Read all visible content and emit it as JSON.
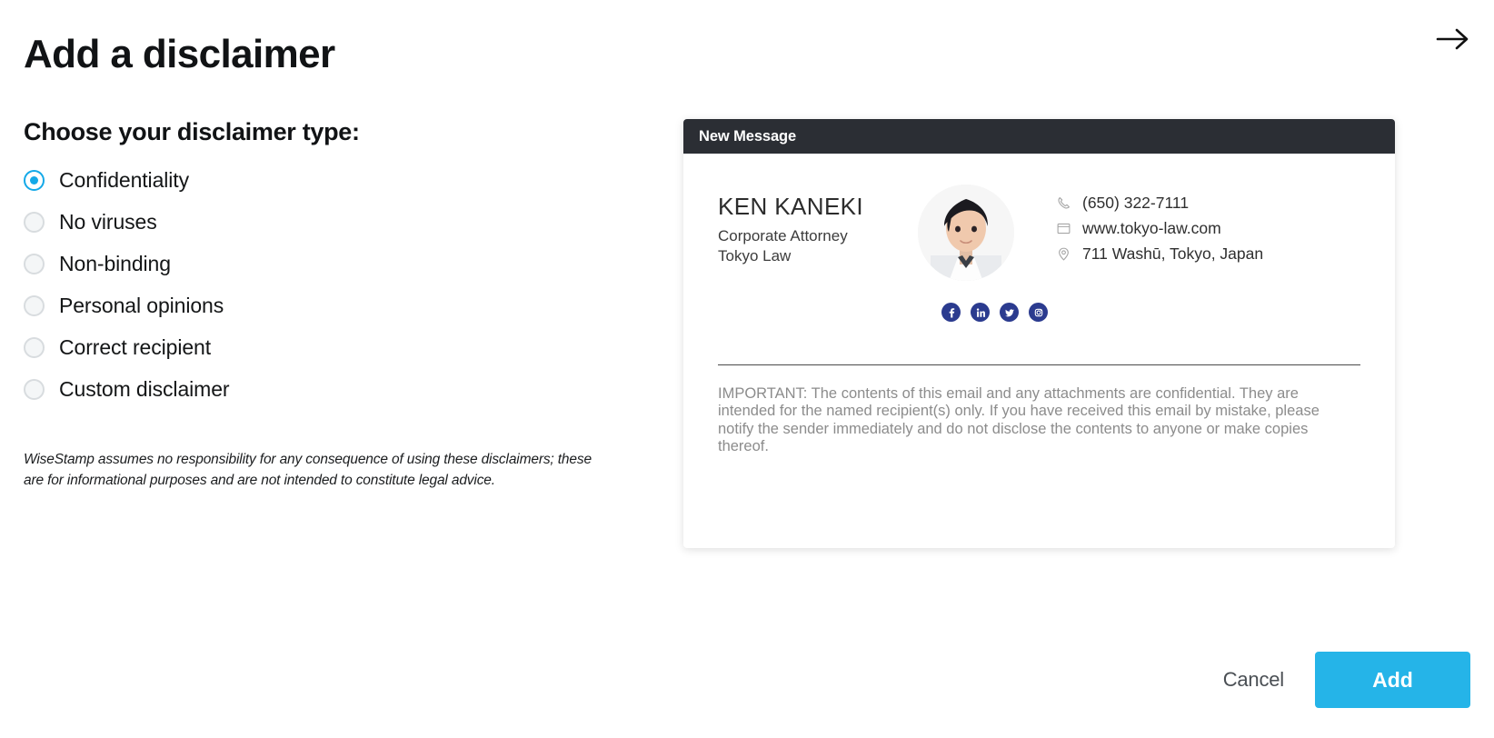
{
  "header": {
    "title": "Add a disclaimer",
    "next_icon": "arrow-right-icon"
  },
  "disclaimer_chooser": {
    "heading": "Choose your disclaimer type:",
    "selected": "Confidentiality",
    "options": [
      {
        "label": "Confidentiality",
        "selected": true
      },
      {
        "label": "No viruses",
        "selected": false
      },
      {
        "label": "Non-binding",
        "selected": false
      },
      {
        "label": "Personal opinions",
        "selected": false
      },
      {
        "label": "Correct recipient",
        "selected": false
      },
      {
        "label": "Custom disclaimer",
        "selected": false
      }
    ],
    "legal_note": "WiseStamp assumes no responsibility for any consequence of using these disclaimers; these are for informational purposes and are not intended to constitute legal advice."
  },
  "preview": {
    "header_title": "New Message",
    "signature": {
      "name": "KEN KANEKI",
      "role": "Corporate Attorney",
      "company": "Tokyo Law",
      "photo_alt": "portrait-photo",
      "contacts": [
        {
          "icon": "phone-icon",
          "value": "(650) 322-7111"
        },
        {
          "icon": "website-icon",
          "value": "www.tokyo-law.com"
        },
        {
          "icon": "location-pin-icon",
          "value": "711 Washū, Tokyo, Japan"
        }
      ],
      "social": [
        {
          "icon": "facebook-icon",
          "name": "Facebook"
        },
        {
          "icon": "linkedin-icon",
          "name": "LinkedIn"
        },
        {
          "icon": "twitter-icon",
          "name": "Twitter"
        },
        {
          "icon": "instagram-icon",
          "name": "Instagram"
        }
      ],
      "social_color": "#2b3b8f"
    },
    "disclaimer_text": "IMPORTANT: The contents of this email and any attachments are confidential. They are intended for the named recipient(s) only. If you have received this email by mistake, please notify the sender immediately and do not disclose the contents to anyone or make copies thereof."
  },
  "footer": {
    "cancel_label": "Cancel",
    "add_label": "Add",
    "accent_color": "#25b4e8"
  }
}
